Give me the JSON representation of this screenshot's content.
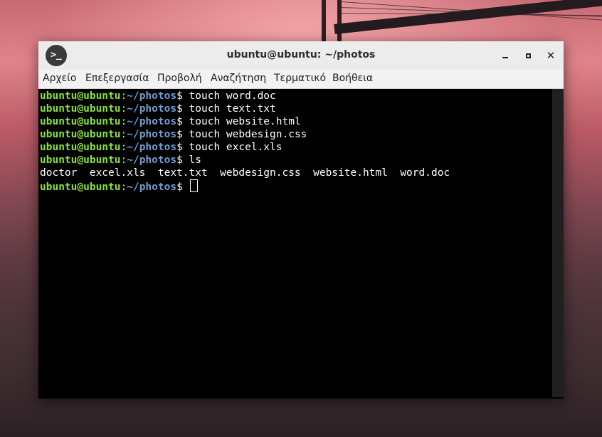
{
  "window": {
    "title": "ubuntu@ubuntu: ~/photos",
    "icon": "terminal-icon",
    "icon_glyph": ">_",
    "close_glyph": "✕"
  },
  "menu": [
    "Αρχείο",
    "Επεξεργασία",
    "Προβολή",
    "Αναζήτηση",
    "Τερματικό",
    "Βοήθεια"
  ],
  "terminal": {
    "prompt_user": "ubuntu@ubuntu",
    "prompt_sep": ":",
    "prompt_path": "~/photos",
    "prompt_symbol": "$",
    "commands": [
      " touch word.doc",
      " touch text.txt",
      " touch website.html",
      " touch webdesign.css",
      " touch excel.xls",
      " ls"
    ],
    "ls_output": "doctor  excel.xls  text.txt  webdesign.css  website.html  word.doc",
    "colors": {
      "user": "#8ae234",
      "path": "#729fcf",
      "background": "#000000"
    }
  }
}
